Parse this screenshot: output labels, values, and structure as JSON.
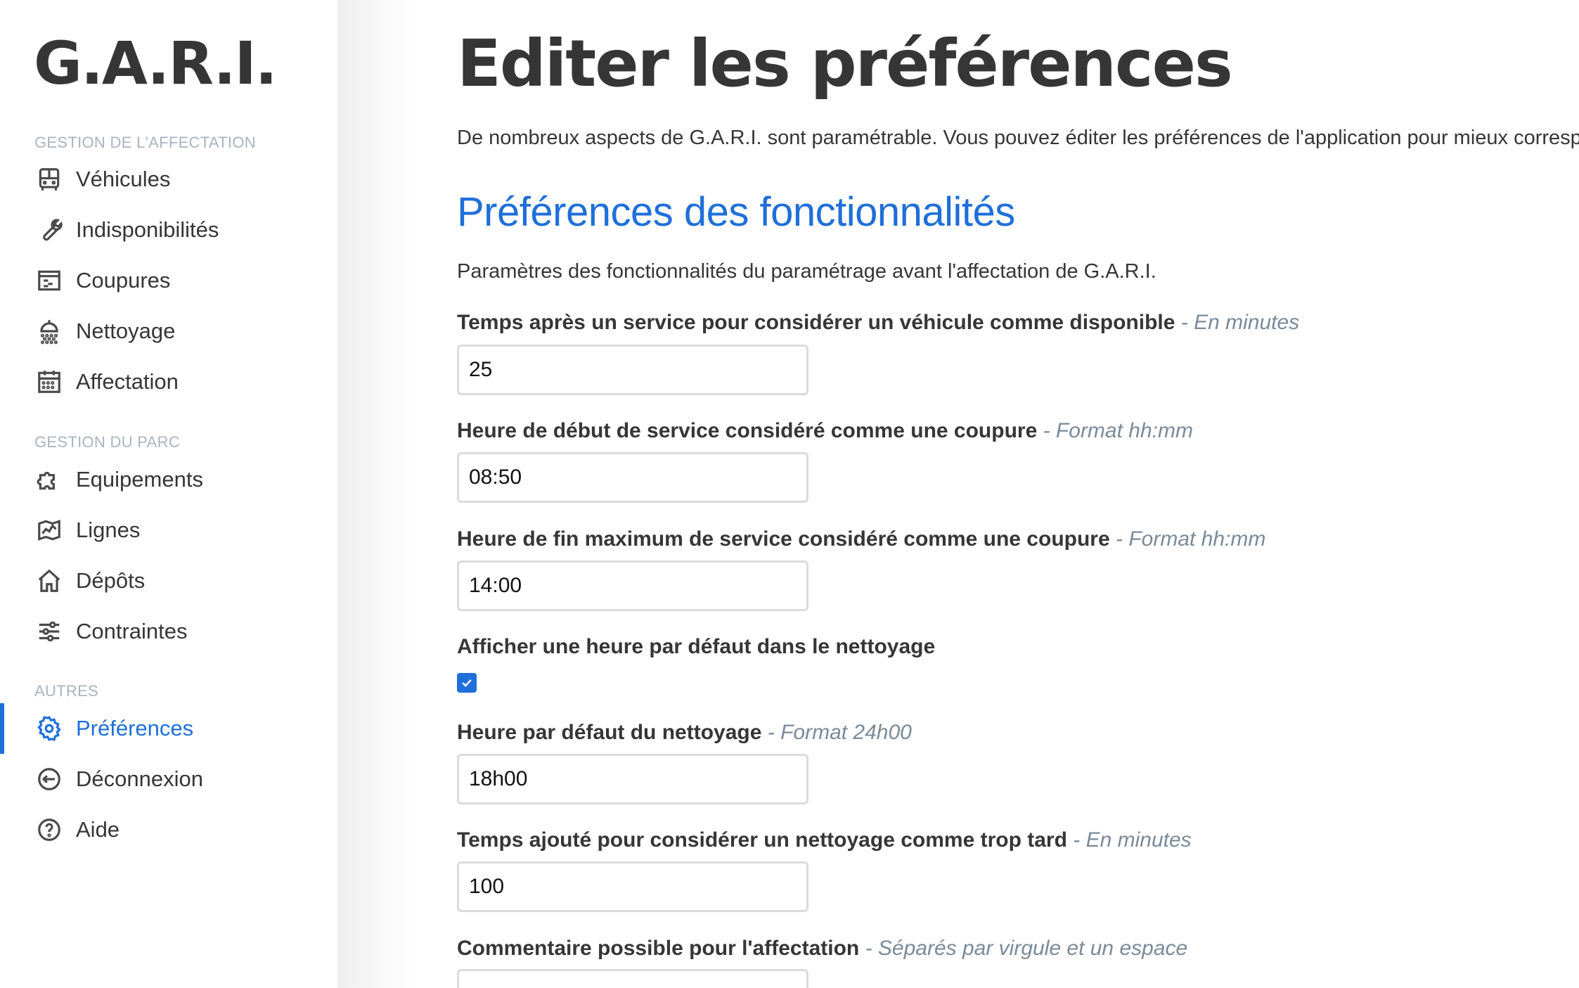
{
  "app": {
    "name": "G.A.R.I."
  },
  "sidebar": {
    "sections": [
      {
        "label": "GESTION DE L'AFFECTATION",
        "items": [
          {
            "label": "Véhicules",
            "icon": "bus-icon"
          },
          {
            "label": "Indisponibilités",
            "icon": "wrench-icon"
          },
          {
            "label": "Coupures",
            "icon": "schedule-icon"
          },
          {
            "label": "Nettoyage",
            "icon": "shower-icon"
          },
          {
            "label": "Affectation",
            "icon": "calendar-icon"
          }
        ]
      },
      {
        "label": "GESTION DU PARC",
        "items": [
          {
            "label": "Equipements",
            "icon": "puzzle-icon"
          },
          {
            "label": "Lignes",
            "icon": "map-icon"
          },
          {
            "label": "Dépôts",
            "icon": "home-icon"
          },
          {
            "label": "Contraintes",
            "icon": "sliders-icon"
          }
        ]
      },
      {
        "label": "AUTRES",
        "items": [
          {
            "label": "Préférences",
            "icon": "gear-icon",
            "active": true
          },
          {
            "label": "Déconnexion",
            "icon": "logout-icon"
          },
          {
            "label": "Aide",
            "icon": "help-icon"
          }
        ]
      }
    ]
  },
  "main": {
    "title": "Editer les préférences",
    "intro": "De nombreux aspects de G.A.R.I. sont paramétrable. Vous pouvez éditer les préférences de l'application pour mieux correspondre",
    "section_title": "Préférences des fonctionnalités",
    "section_desc": "Paramètres des fonctionnalités du paramétrage avant l'affectation de G.A.R.I.",
    "fields": [
      {
        "label": "Temps après un service pour considérer un véhicule comme disponible",
        "hint": "- En minutes",
        "value": "25"
      },
      {
        "label": "Heure de début de service considéré comme une coupure",
        "hint": "- Format hh:mm",
        "value": "08:50"
      },
      {
        "label": "Heure de fin maximum de service considéré comme une coupure",
        "hint": "- Format hh:mm",
        "value": "14:00"
      },
      {
        "label": "Afficher une heure par défaut dans le nettoyage",
        "checked": true
      },
      {
        "label": "Heure par défaut du nettoyage",
        "hint": "- Format 24h00",
        "value": "18h00"
      },
      {
        "label": "Temps ajouté pour considérer un nettoyage comme trop tard",
        "hint": "- En minutes",
        "value": "100"
      },
      {
        "label": "Commentaire possible pour l'affectation",
        "hint": "- Séparés par virgule et un espace",
        "value": ""
      }
    ]
  },
  "colors": {
    "accent": "#1e6fd9",
    "text": "#363636",
    "muted": "#a9b4bf"
  }
}
